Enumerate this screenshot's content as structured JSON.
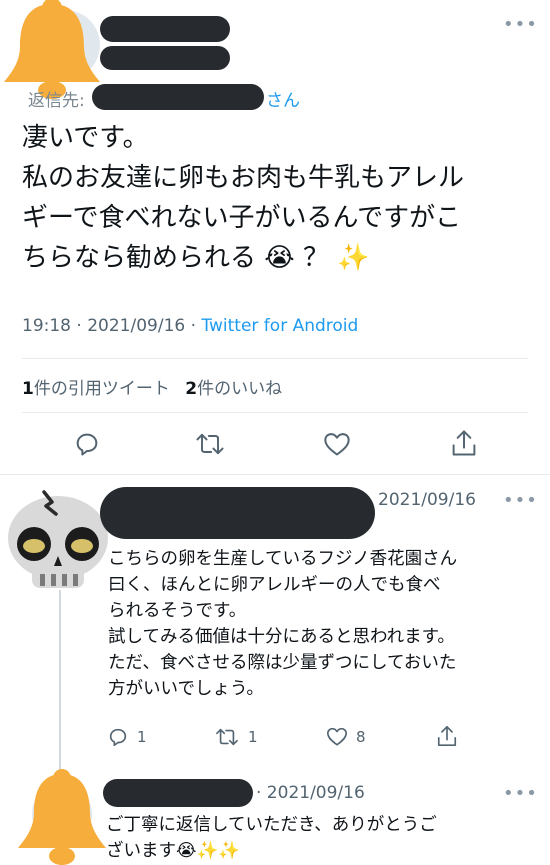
{
  "main_tweet": {
    "reply_prefix": "返信先:",
    "reply_suffix": "さん",
    "text_lines": [
      "凄いです。",
      "私のお友達に卵もお肉も牛乳もアレル",
      "ギーで食べれない子がいるんですがこ",
      "ちらなら勧められる"
    ],
    "text_end": "？",
    "emojis": {
      "crying": "😭",
      "sparkles": "✨"
    },
    "time": "19:18",
    "date": "2021/09/16",
    "client": "Twitter for Android",
    "sep": "·",
    "quote_count": "1",
    "quote_label": "件の引用ツイート",
    "like_count": "2",
    "like_label": "件のいいね",
    "more": "•••"
  },
  "reply1": {
    "date": "2021/09/16",
    "more": "•••",
    "text_lines": [
      "こちらの卵を生産しているフジノ香花園さん",
      "曰く、ほんとに卵アレルギーの人でも食べ",
      "られるそうです。",
      "試してみる価値は十分にあると思われます。",
      "ただ、食べさせる際は少量ずつにしておいた",
      "方がいいでしょう。"
    ],
    "reply_count": "1",
    "retweet_count": "1",
    "like_count": "8"
  },
  "reply2": {
    "date": "· 2021/09/16",
    "more": "•••",
    "text_lines": [
      "ご丁寧に返信していただき、ありがとうご",
      "ざいます"
    ],
    "emojis": {
      "crying": "😭",
      "sparkles": "✨"
    }
  },
  "colors": {
    "accent": "#1d9bf0",
    "redaction": "#272b30",
    "bell": "#f6ad3c",
    "text": "#0f1419",
    "secondary": "#536471"
  },
  "icons": [
    "bell-icon",
    "skull-icon",
    "reply-icon",
    "retweet-icon",
    "like-icon",
    "share-icon",
    "more-icon"
  ]
}
